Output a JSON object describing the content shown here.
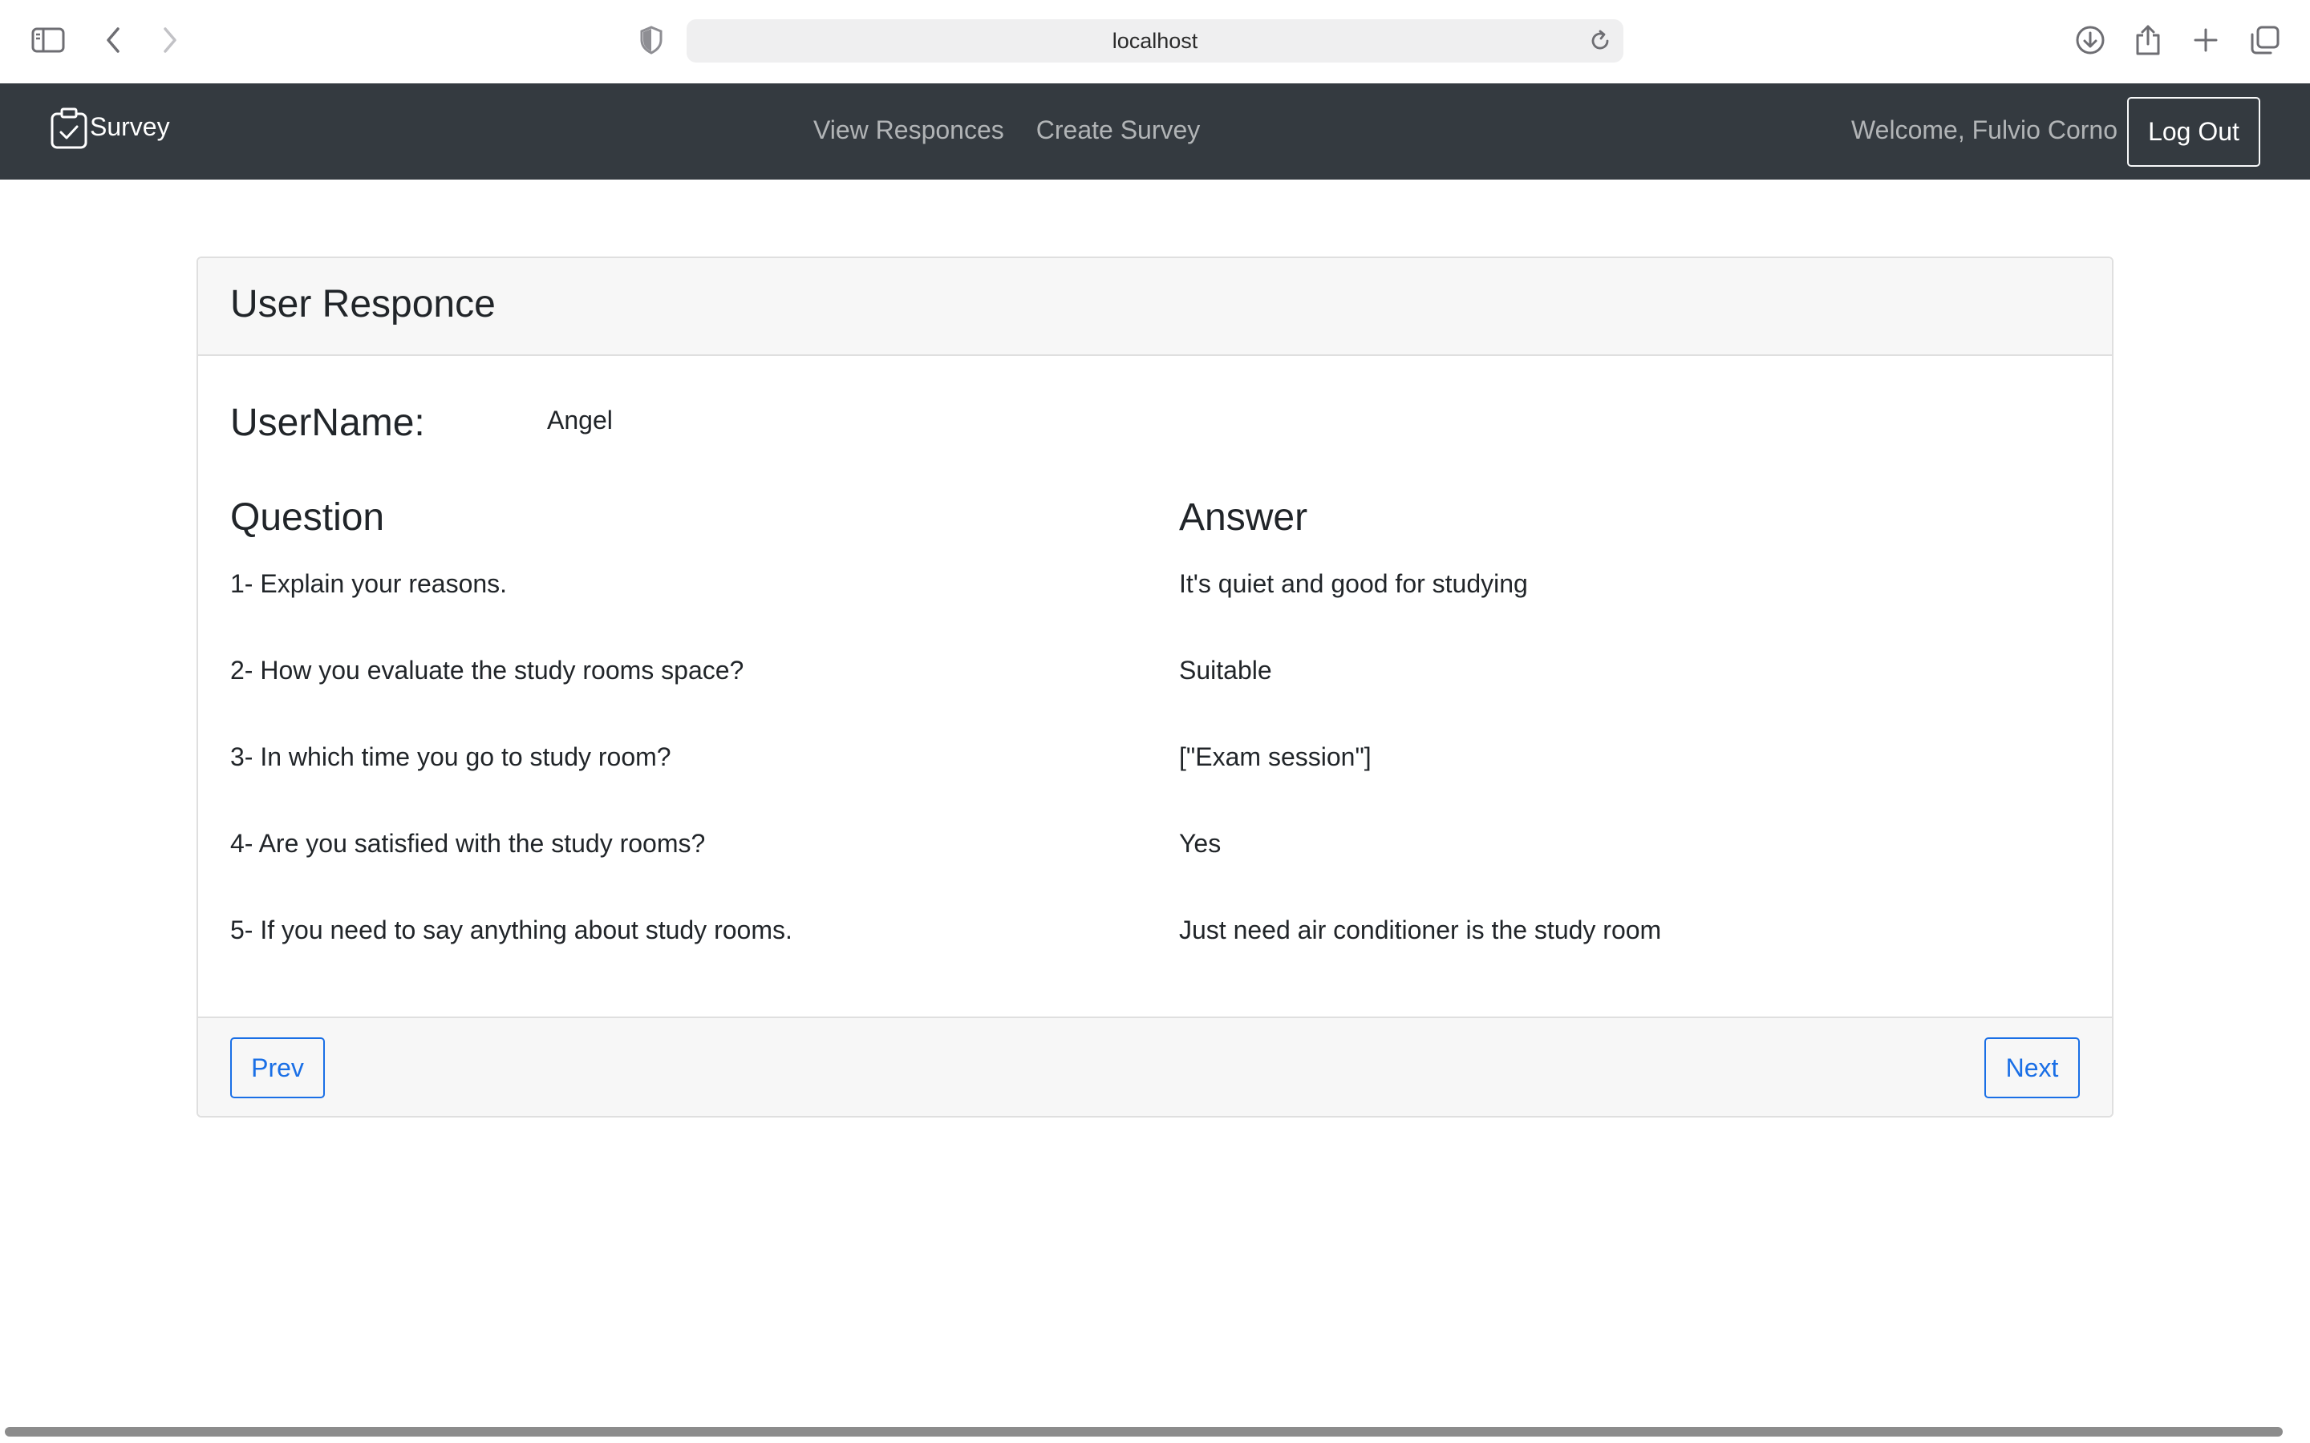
{
  "browser": {
    "address": "localhost"
  },
  "navbar": {
    "brand": "Survey",
    "links": [
      {
        "label": "View Responces"
      },
      {
        "label": "Create Survey"
      }
    ],
    "welcome": "Welcome, Fulvio Corno",
    "logout_label": "Log Out"
  },
  "card": {
    "title": "User Responce",
    "username_label": "UserName:",
    "username_value": "Angel",
    "question_heading": "Question",
    "answer_heading": "Answer",
    "rows": [
      {
        "question": "1- Explain your reasons.",
        "answer": "It's quiet and good for studying"
      },
      {
        "question": "2- How you evaluate the study rooms space?",
        "answer": "Suitable"
      },
      {
        "question": "3- In which time you go to study room?",
        "answer": "[\"Exam session\"]"
      },
      {
        "question": "4- Are you satisfied with the study rooms?",
        "answer": "Yes"
      },
      {
        "question": "5- If you need to say anything about study rooms.",
        "answer": "Just need air conditioner is the study room"
      }
    ],
    "prev_label": "Prev",
    "next_label": "Next"
  },
  "colors": {
    "navbar_bg": "#343a40",
    "primary": "#1a6fe6",
    "card_header_bg": "#f7f7f7"
  }
}
